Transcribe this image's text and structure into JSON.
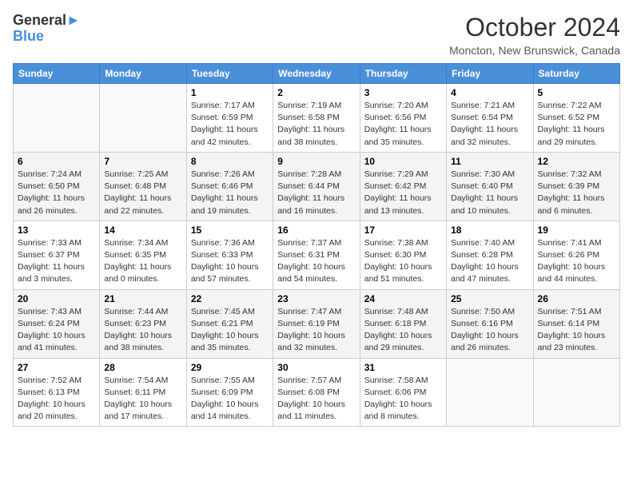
{
  "header": {
    "logo_line1": "General",
    "logo_line2": "Blue",
    "month": "October 2024",
    "location": "Moncton, New Brunswick, Canada"
  },
  "weekdays": [
    "Sunday",
    "Monday",
    "Tuesday",
    "Wednesday",
    "Thursday",
    "Friday",
    "Saturday"
  ],
  "weeks": [
    [
      {
        "day": "",
        "sunrise": "",
        "sunset": "",
        "daylight": ""
      },
      {
        "day": "",
        "sunrise": "",
        "sunset": "",
        "daylight": ""
      },
      {
        "day": "1",
        "sunrise": "Sunrise: 7:17 AM",
        "sunset": "Sunset: 6:59 PM",
        "daylight": "Daylight: 11 hours and 42 minutes."
      },
      {
        "day": "2",
        "sunrise": "Sunrise: 7:19 AM",
        "sunset": "Sunset: 6:58 PM",
        "daylight": "Daylight: 11 hours and 38 minutes."
      },
      {
        "day": "3",
        "sunrise": "Sunrise: 7:20 AM",
        "sunset": "Sunset: 6:56 PM",
        "daylight": "Daylight: 11 hours and 35 minutes."
      },
      {
        "day": "4",
        "sunrise": "Sunrise: 7:21 AM",
        "sunset": "Sunset: 6:54 PM",
        "daylight": "Daylight: 11 hours and 32 minutes."
      },
      {
        "day": "5",
        "sunrise": "Sunrise: 7:22 AM",
        "sunset": "Sunset: 6:52 PM",
        "daylight": "Daylight: 11 hours and 29 minutes."
      }
    ],
    [
      {
        "day": "6",
        "sunrise": "Sunrise: 7:24 AM",
        "sunset": "Sunset: 6:50 PM",
        "daylight": "Daylight: 11 hours and 26 minutes."
      },
      {
        "day": "7",
        "sunrise": "Sunrise: 7:25 AM",
        "sunset": "Sunset: 6:48 PM",
        "daylight": "Daylight: 11 hours and 22 minutes."
      },
      {
        "day": "8",
        "sunrise": "Sunrise: 7:26 AM",
        "sunset": "Sunset: 6:46 PM",
        "daylight": "Daylight: 11 hours and 19 minutes."
      },
      {
        "day": "9",
        "sunrise": "Sunrise: 7:28 AM",
        "sunset": "Sunset: 6:44 PM",
        "daylight": "Daylight: 11 hours and 16 minutes."
      },
      {
        "day": "10",
        "sunrise": "Sunrise: 7:29 AM",
        "sunset": "Sunset: 6:42 PM",
        "daylight": "Daylight: 11 hours and 13 minutes."
      },
      {
        "day": "11",
        "sunrise": "Sunrise: 7:30 AM",
        "sunset": "Sunset: 6:40 PM",
        "daylight": "Daylight: 11 hours and 10 minutes."
      },
      {
        "day": "12",
        "sunrise": "Sunrise: 7:32 AM",
        "sunset": "Sunset: 6:39 PM",
        "daylight": "Daylight: 11 hours and 6 minutes."
      }
    ],
    [
      {
        "day": "13",
        "sunrise": "Sunrise: 7:33 AM",
        "sunset": "Sunset: 6:37 PM",
        "daylight": "Daylight: 11 hours and 3 minutes."
      },
      {
        "day": "14",
        "sunrise": "Sunrise: 7:34 AM",
        "sunset": "Sunset: 6:35 PM",
        "daylight": "Daylight: 11 hours and 0 minutes."
      },
      {
        "day": "15",
        "sunrise": "Sunrise: 7:36 AM",
        "sunset": "Sunset: 6:33 PM",
        "daylight": "Daylight: 10 hours and 57 minutes."
      },
      {
        "day": "16",
        "sunrise": "Sunrise: 7:37 AM",
        "sunset": "Sunset: 6:31 PM",
        "daylight": "Daylight: 10 hours and 54 minutes."
      },
      {
        "day": "17",
        "sunrise": "Sunrise: 7:38 AM",
        "sunset": "Sunset: 6:30 PM",
        "daylight": "Daylight: 10 hours and 51 minutes."
      },
      {
        "day": "18",
        "sunrise": "Sunrise: 7:40 AM",
        "sunset": "Sunset: 6:28 PM",
        "daylight": "Daylight: 10 hours and 47 minutes."
      },
      {
        "day": "19",
        "sunrise": "Sunrise: 7:41 AM",
        "sunset": "Sunset: 6:26 PM",
        "daylight": "Daylight: 10 hours and 44 minutes."
      }
    ],
    [
      {
        "day": "20",
        "sunrise": "Sunrise: 7:43 AM",
        "sunset": "Sunset: 6:24 PM",
        "daylight": "Daylight: 10 hours and 41 minutes."
      },
      {
        "day": "21",
        "sunrise": "Sunrise: 7:44 AM",
        "sunset": "Sunset: 6:23 PM",
        "daylight": "Daylight: 10 hours and 38 minutes."
      },
      {
        "day": "22",
        "sunrise": "Sunrise: 7:45 AM",
        "sunset": "Sunset: 6:21 PM",
        "daylight": "Daylight: 10 hours and 35 minutes."
      },
      {
        "day": "23",
        "sunrise": "Sunrise: 7:47 AM",
        "sunset": "Sunset: 6:19 PM",
        "daylight": "Daylight: 10 hours and 32 minutes."
      },
      {
        "day": "24",
        "sunrise": "Sunrise: 7:48 AM",
        "sunset": "Sunset: 6:18 PM",
        "daylight": "Daylight: 10 hours and 29 minutes."
      },
      {
        "day": "25",
        "sunrise": "Sunrise: 7:50 AM",
        "sunset": "Sunset: 6:16 PM",
        "daylight": "Daylight: 10 hours and 26 minutes."
      },
      {
        "day": "26",
        "sunrise": "Sunrise: 7:51 AM",
        "sunset": "Sunset: 6:14 PM",
        "daylight": "Daylight: 10 hours and 23 minutes."
      }
    ],
    [
      {
        "day": "27",
        "sunrise": "Sunrise: 7:52 AM",
        "sunset": "Sunset: 6:13 PM",
        "daylight": "Daylight: 10 hours and 20 minutes."
      },
      {
        "day": "28",
        "sunrise": "Sunrise: 7:54 AM",
        "sunset": "Sunset: 6:11 PM",
        "daylight": "Daylight: 10 hours and 17 minutes."
      },
      {
        "day": "29",
        "sunrise": "Sunrise: 7:55 AM",
        "sunset": "Sunset: 6:09 PM",
        "daylight": "Daylight: 10 hours and 14 minutes."
      },
      {
        "day": "30",
        "sunrise": "Sunrise: 7:57 AM",
        "sunset": "Sunset: 6:08 PM",
        "daylight": "Daylight: 10 hours and 11 minutes."
      },
      {
        "day": "31",
        "sunrise": "Sunrise: 7:58 AM",
        "sunset": "Sunset: 6:06 PM",
        "daylight": "Daylight: 10 hours and 8 minutes."
      },
      {
        "day": "",
        "sunrise": "",
        "sunset": "",
        "daylight": ""
      },
      {
        "day": "",
        "sunrise": "",
        "sunset": "",
        "daylight": ""
      }
    ]
  ]
}
